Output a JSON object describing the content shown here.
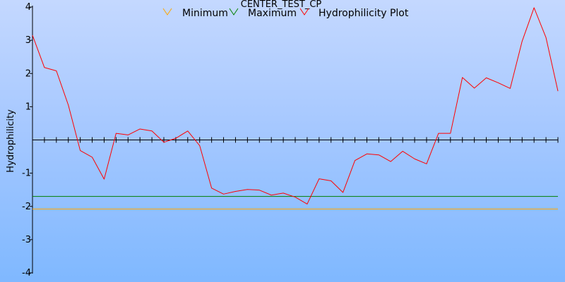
{
  "chart_data": {
    "type": "line",
    "title": "CENTER_TEST_CP",
    "xlabel": "",
    "ylabel": "Hydrophilicity",
    "ylim": [
      -4,
      4
    ],
    "yticks": [
      4,
      3,
      2,
      1,
      -1,
      -2,
      -3,
      -4
    ],
    "xlim": [
      1,
      45
    ],
    "x": [
      1,
      2,
      3,
      4,
      5,
      6,
      7,
      8,
      9,
      10,
      11,
      12,
      13,
      14,
      15,
      16,
      17,
      18,
      19,
      20,
      21,
      22,
      23,
      24,
      25,
      26,
      27,
      28,
      29,
      30,
      31,
      32,
      33,
      34,
      35,
      36,
      37,
      38,
      39,
      40,
      41,
      42,
      43,
      44,
      45
    ],
    "grid": false,
    "legend_position": "top-center",
    "series": [
      {
        "name": "Minimum",
        "color": "#ffa500",
        "values": [
          -2.08,
          -2.08,
          -2.08,
          -2.08,
          -2.08,
          -2.08,
          -2.08,
          -2.08,
          -2.08,
          -2.08,
          -2.08,
          -2.08,
          -2.08,
          -2.08,
          -2.08,
          -2.08,
          -2.08,
          -2.08,
          -2.08,
          -2.08,
          -2.08,
          -2.08,
          -2.08,
          -2.08,
          -2.08,
          -2.08,
          -2.08,
          -2.08,
          -2.08,
          -2.08,
          -2.08,
          -2.08,
          -2.08,
          -2.08,
          -2.08,
          -2.08,
          -2.08,
          -2.08,
          -2.08,
          -2.08,
          -2.08,
          -2.08,
          -2.08,
          -2.08,
          -2.08
        ]
      },
      {
        "name": "Maximum",
        "color": "#008000",
        "values": [
          -1.7,
          -1.7,
          -1.7,
          -1.7,
          -1.7,
          -1.7,
          -1.7,
          -1.7,
          -1.7,
          -1.7,
          -1.7,
          -1.7,
          -1.7,
          -1.7,
          -1.7,
          -1.7,
          -1.7,
          -1.7,
          -1.7,
          -1.7,
          -1.7,
          -1.7,
          -1.7,
          -1.7,
          -1.7,
          -1.7,
          -1.7,
          -1.7,
          -1.7,
          -1.7,
          -1.7,
          -1.7,
          -1.7,
          -1.7,
          -1.7,
          -1.7,
          -1.7,
          -1.7,
          -1.7,
          -1.7,
          -1.7,
          -1.7,
          -1.7,
          -1.7,
          -1.7
        ]
      },
      {
        "name": "Hydrophilicity Plot",
        "color": "#ff0000",
        "values": [
          3.15,
          2.18,
          2.08,
          1.05,
          -0.32,
          -0.52,
          -1.18,
          0.2,
          0.15,
          0.33,
          0.27,
          -0.07,
          0.05,
          0.27,
          -0.17,
          -1.45,
          -1.63,
          -1.55,
          -1.49,
          -1.51,
          -1.66,
          -1.6,
          -1.72,
          -1.93,
          -1.17,
          -1.23,
          -1.58,
          -0.62,
          -0.42,
          -0.45,
          -0.65,
          -0.34,
          -0.57,
          -0.72,
          0.2,
          0.2,
          1.88,
          1.56,
          1.87,
          1.72,
          1.55,
          2.97,
          3.98,
          3.08,
          1.47
        ]
      }
    ]
  }
}
